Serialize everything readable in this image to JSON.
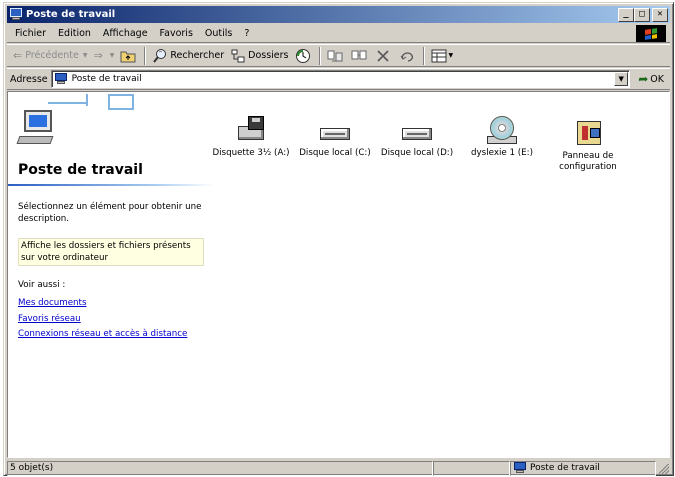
{
  "window": {
    "title": "Poste de travail",
    "controls": {
      "minimize": "_",
      "maximize": "□",
      "close": "✕"
    }
  },
  "menubar": {
    "items": [
      "Fichier",
      "Edition",
      "Affichage",
      "Favoris",
      "Outils",
      "?"
    ]
  },
  "toolbar": {
    "back_label": "Précédente",
    "search_label": "Rechercher",
    "folders_label": "Dossiers"
  },
  "address": {
    "label": "Adresse",
    "value": "Poste de travail",
    "go_label": "OK"
  },
  "leftpane": {
    "title": "Poste de travail",
    "description": "Sélectionnez un élément pour obtenir une description.",
    "tip": "Affiche les dossiers et fichiers présents sur votre ordinateur",
    "see_also": "Voir aussi :",
    "links": [
      "Mes documents",
      "Favoris réseau",
      "Connexions réseau et accès à distance"
    ]
  },
  "items": [
    {
      "label": "Disquette 3½ (A:)",
      "icon": "floppy-drive-icon"
    },
    {
      "label": "Disque local (C:)",
      "icon": "hard-disk-icon"
    },
    {
      "label": "Disque local (D:)",
      "icon": "hard-disk-icon"
    },
    {
      "label": "dyslexie 1 (E:)",
      "icon": "cd-drive-icon"
    },
    {
      "label": "Panneau de configuration",
      "icon": "control-panel-icon"
    }
  ],
  "statusbar": {
    "count": "5 objet(s)",
    "location": "Poste de travail"
  },
  "colors": {
    "title_start": "#0a246a",
    "title_end": "#a6caf0",
    "chrome": "#d4d0c8",
    "link": "#0000cc",
    "tip_bg": "#ffffe1"
  }
}
